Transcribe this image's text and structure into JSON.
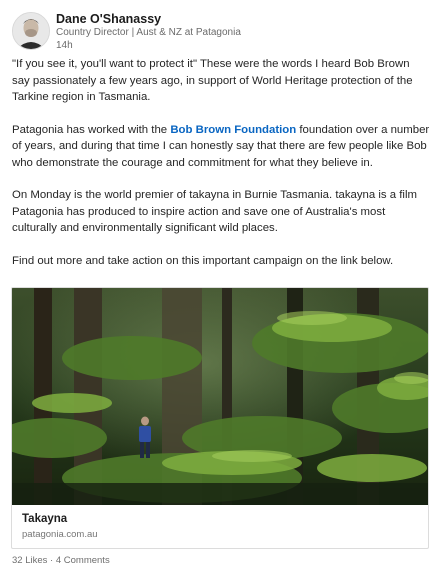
{
  "author": {
    "name": "Dane O'Shanassy",
    "title": "Country Director | Aust & NZ at Patagonia",
    "time": "14h"
  },
  "post": {
    "p1": "\"If you see it, you'll want to protect it\" These were the words I heard Bob Brown say passionately a few years ago, in support of World Heritage protection of the Tarkine region in Tasmania.",
    "p2_before": "Patagonia has worked with the ",
    "p2_link": "Bob Brown Foundation",
    "p2_after": " foundation over a number of years, and during that time I can honestly say that there are few people like Bob who demonstrate the courage and commitment for what they believe in.",
    "p3": "On Monday is the world premier of takayna in Burnie Tasmania. takayna is a film Patagonia has produced to inspire action and save one of Australia's most culturally and environmentally significant wild places.",
    "p4": "Find out more and take action on this important campaign on the link below."
  },
  "card": {
    "title": "Takayna",
    "domain": "patagonia.com.au"
  },
  "social": {
    "likes": "32 Likes",
    "separator": " · ",
    "comments": "4 Comments"
  },
  "colors": {
    "link": "#0a66c2",
    "meta_text": "#6b6b6b"
  }
}
